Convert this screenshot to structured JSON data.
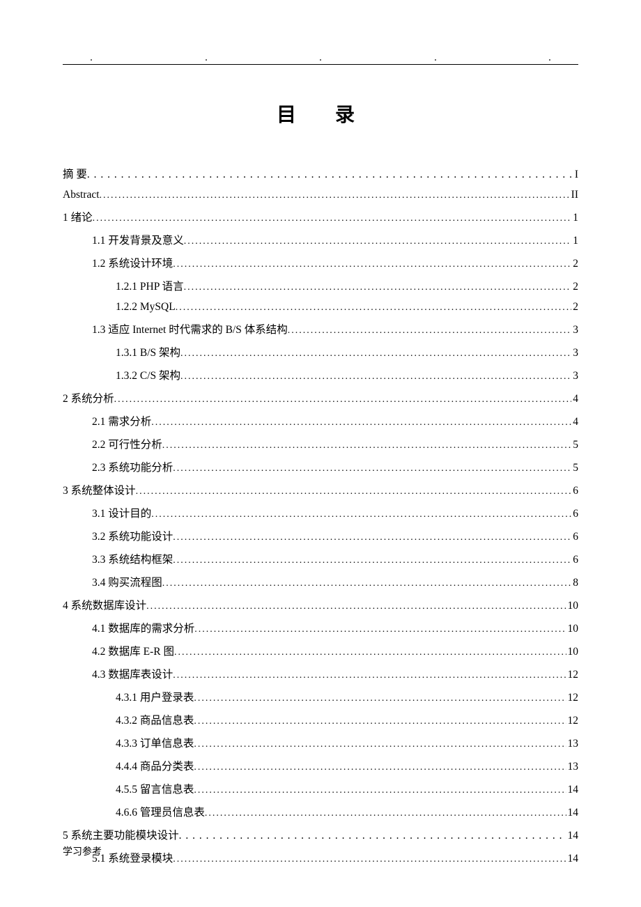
{
  "header": {
    "title": "目　录"
  },
  "toc": {
    "entries": [
      {
        "level": 0,
        "label": "摘 要",
        "page": "I",
        "leader": "wide"
      },
      {
        "level": 0,
        "label": "Abstract",
        "page": "II",
        "leader": "std"
      },
      {
        "level": 0,
        "label": "1 绪论",
        "page": "1",
        "leader": "std"
      },
      {
        "level": 1,
        "label": "1.1  开发背景及意义",
        "page": "1",
        "leader": "std"
      },
      {
        "level": 1,
        "label": "1.2  系统设计环境",
        "page": "2",
        "leader": "std"
      },
      {
        "level": 2,
        "label": "1.2.1 PHP 语言",
        "page": "2",
        "leader": "std"
      },
      {
        "level": 2,
        "label": "1.2.2 MySQL",
        "page": "2",
        "leader": "std"
      },
      {
        "level": 1,
        "label": "1.3  适应 Internet 时代需求的 B/S 体系结构",
        "page": "3",
        "leader": "std"
      },
      {
        "level": 2,
        "label": "1.3.1 B/S 架构",
        "page": "3",
        "leader": "std"
      },
      {
        "level": 2,
        "label": "1.3.2 C/S 架构",
        "page": "3",
        "leader": "std"
      },
      {
        "level": 0,
        "label": "2 系统分析",
        "page": "4",
        "leader": "std"
      },
      {
        "level": 1,
        "label": "2.1  需求分析",
        "page": "4",
        "leader": "std"
      },
      {
        "level": 1,
        "label": "2.2  可行性分析",
        "page": "5",
        "leader": "std"
      },
      {
        "level": 1,
        "label": "2.3  系统功能分析",
        "page": "5",
        "leader": "std"
      },
      {
        "level": 0,
        "label": "3 系统整体设计",
        "page": "6",
        "leader": "std"
      },
      {
        "level": 1,
        "label": "3.1  设计目的",
        "page": "6",
        "leader": "std"
      },
      {
        "level": 1,
        "label": "3.2  系统功能设计",
        "page": "6",
        "leader": "std"
      },
      {
        "level": 1,
        "label": "3.3  系统结构框架",
        "page": "6",
        "leader": "std"
      },
      {
        "level": 1,
        "label": "3.4  购买流程图",
        "page": "8",
        "leader": "std"
      },
      {
        "level": 0,
        "label": "4 系统数据库设计",
        "page": "10",
        "leader": "std"
      },
      {
        "level": 1,
        "label": "4.1  数据库的需求分析",
        "page": "10",
        "leader": "std"
      },
      {
        "level": 1,
        "label": "4.2  数据库 E-R 图",
        "page": "10",
        "leader": "std"
      },
      {
        "level": 1,
        "label": "4.3  数据库表设计",
        "page": "12",
        "leader": "std"
      },
      {
        "level": 2,
        "label": "4.3.1  用户登录表",
        "page": "12",
        "leader": "std"
      },
      {
        "level": 2,
        "label": "4.3.2  商品信息表",
        "page": "12",
        "leader": "std"
      },
      {
        "level": 2,
        "label": "4.3.3  订单信息表",
        "page": "13",
        "leader": "std"
      },
      {
        "level": 2,
        "label": "4.4.4  商品分类表",
        "page": "13",
        "leader": "std"
      },
      {
        "level": 2,
        "label": "4.5.5  留言信息表",
        "page": "14",
        "leader": "std"
      },
      {
        "level": 2,
        "label": "4.6.6  管理员信息表",
        "page": "14",
        "leader": "std"
      },
      {
        "level": 0,
        "label": "5 系统主要功能模块设计",
        "page": "14",
        "leader": "wide"
      },
      {
        "level": 1,
        "label": "5.1  系统登录模块",
        "page": "14",
        "leader": "std"
      }
    ]
  },
  "footer": {
    "text": "学习参考"
  }
}
